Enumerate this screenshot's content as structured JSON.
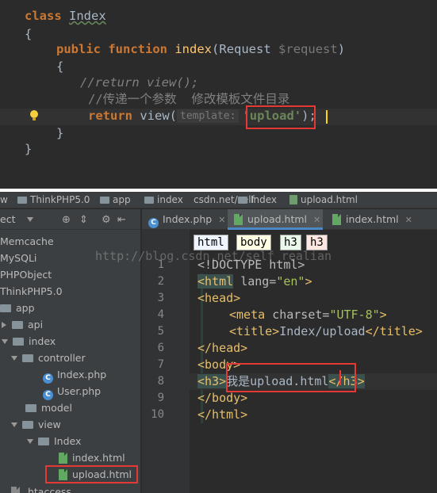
{
  "top_code": {
    "line1": {
      "kw": "class",
      "name": "Index"
    },
    "line2": "{",
    "line3": {
      "kw1": "public",
      "kw2": "function",
      "fn": "index",
      "open": "(",
      "type": "Request",
      "var": "$request",
      "close": ")"
    },
    "line4": "{",
    "line5": "//return view();",
    "line6": "//传递一个参数  修改模板文件目录",
    "line7": {
      "kw": "return",
      "fn": "view",
      "open": "(",
      "hint": "template:",
      "str": "'upload'",
      "close": ");"
    },
    "line8": "}",
    "line9": "}"
  },
  "breadcrumb": [
    "w",
    "ThinkPHP5.0",
    "app",
    "index",
    "csdn.net/self",
    "Index",
    "upload.html"
  ],
  "sidebar": {
    "header_label": "ect",
    "items": [
      {
        "label": "Memcache"
      },
      {
        "label": "MySQLi"
      },
      {
        "label": "PHPObject"
      },
      {
        "label": "ThinkPHP5.0"
      },
      {
        "label": "app"
      },
      {
        "label": "api"
      },
      {
        "label": "index"
      },
      {
        "label": "controller"
      },
      {
        "label": "Index.php"
      },
      {
        "label": "User.php"
      },
      {
        "label": "model"
      },
      {
        "label": "view"
      },
      {
        "label": "Index"
      },
      {
        "label": "index.html"
      },
      {
        "label": "upload.html"
      },
      {
        "label": ".htaccess"
      }
    ]
  },
  "tabs": [
    {
      "label": "Index.php"
    },
    {
      "label": "upload.html"
    },
    {
      "label": "index.html"
    }
  ],
  "tag_breadcrumb": [
    "html",
    "body",
    "h3",
    "h3"
  ],
  "line_numbers": [
    "1",
    "2",
    "3",
    "4",
    "5",
    "6",
    "7",
    "8",
    "9",
    "10"
  ],
  "editor": {
    "l1": "<!DOCTYPE html>",
    "l2_open": "<html",
    "l2_attr": "lang=",
    "l2_val": "\"en\"",
    "l2_close": ">",
    "l3": "<head>",
    "l4_open": "<meta",
    "l4_attr": "charset=",
    "l4_val": "\"UTF-8\"",
    "l4_close": ">",
    "l5_open": "<title>",
    "l5_text": "Index/upload",
    "l5_close": "</title>",
    "l6": "</head>",
    "l7": "<body>",
    "l8_open": "<h3>",
    "l8_text": "我是upload.html",
    "l8_close1": "<",
    "l8_close2": "/h3>",
    "l9": "</body>",
    "l10": "</html>"
  },
  "watermark": "http://blog.csdn.net/self_realian",
  "colors": {
    "highlight_box": "#e53935",
    "keyword": "#cc7832",
    "string": "#6a8759",
    "tag": "#e8bf6a"
  }
}
